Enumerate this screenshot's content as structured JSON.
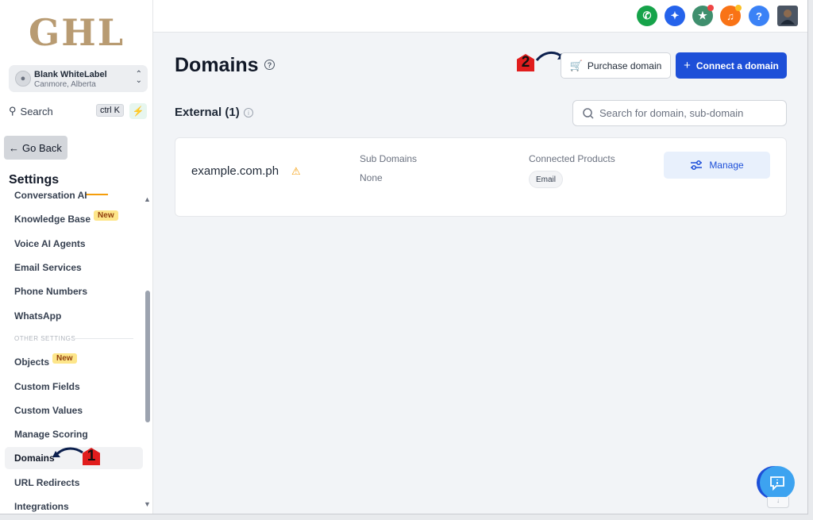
{
  "brand": {
    "logo_text": "GHL"
  },
  "account": {
    "name": "Blank WhiteLabel",
    "location": "Canmore, Alberta"
  },
  "search": {
    "label": "Search",
    "shortcut": "ctrl K"
  },
  "sidebar": {
    "go_back": "Go Back",
    "settings_title": "Settings",
    "items": [
      {
        "label": "Conversation AI"
      },
      {
        "label": "Knowledge Base",
        "badge": "New"
      },
      {
        "label": "Voice AI Agents"
      },
      {
        "label": "Email Services"
      },
      {
        "label": "Phone Numbers"
      },
      {
        "label": "WhatsApp"
      }
    ],
    "section_other": "OTHER SETTINGS",
    "other_items": [
      {
        "label": "Objects",
        "badge": "New"
      },
      {
        "label": "Custom Fields"
      },
      {
        "label": "Custom Values"
      },
      {
        "label": "Manage Scoring"
      },
      {
        "label": "Domains",
        "active": true
      },
      {
        "label": "URL Redirects"
      },
      {
        "label": "Integrations"
      }
    ]
  },
  "topbar": {
    "icons": [
      {
        "name": "phone-icon",
        "color": "#16a34a"
      },
      {
        "name": "magic-wand-icon",
        "color": "#2563eb"
      },
      {
        "name": "megaphone-icon",
        "color": "#3f8f6e"
      },
      {
        "name": "bell-icon",
        "color": "#f97316"
      },
      {
        "name": "help-icon",
        "color": "#3b82f6",
        "glyph": "?"
      }
    ]
  },
  "main": {
    "title": "Domains",
    "purchase_label": "Purchase domain",
    "connect_label": "Connect a domain",
    "external_title": "External (1)",
    "search_placeholder": "Search for domain, sub-domain",
    "domain": {
      "name": "example.com.ph",
      "sub_domains_label": "Sub Domains",
      "sub_domains_value": "None",
      "connected_label": "Connected Products",
      "connected_chip": "Email",
      "manage_label": "Manage"
    }
  },
  "annotations": {
    "step1": "1",
    "step2": "2"
  },
  "colors": {
    "primary": "#1d4fd8",
    "warning": "#f59e0b",
    "annotation": "#e11d1d"
  }
}
